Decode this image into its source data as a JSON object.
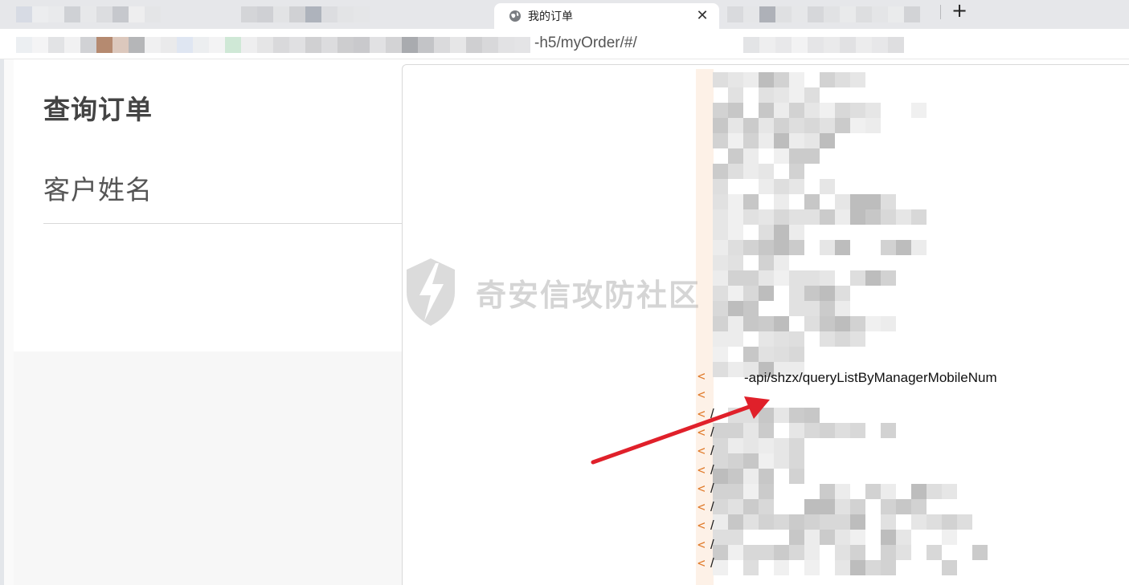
{
  "browser": {
    "tab": {
      "title": "我的订单",
      "favicon": "globe-icon",
      "close_glyph": "✕"
    },
    "new_tab_glyph": "+",
    "address": {
      "url_visible": "-h5/myOrder/#/"
    }
  },
  "page": {
    "title": "查询订单",
    "field_label": "客户姓名"
  },
  "code": {
    "highlighted_line": "-api/shzx/queryListByManagerMobileNum",
    "slash_glyph": "/",
    "marker_glyph": "<"
  },
  "watermark": {
    "text": "奇安信攻防社区",
    "logo": "lightning-shield-icon"
  },
  "annotation": {
    "arrow_color": "#e0202a"
  }
}
